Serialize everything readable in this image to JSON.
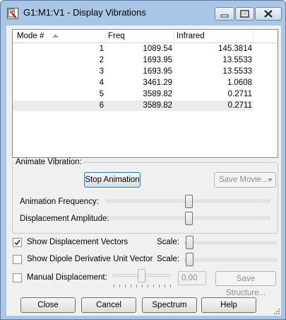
{
  "window": {
    "title": "G1:M1:V1 - Display Vibrations"
  },
  "table": {
    "headers": {
      "mode": "Mode #",
      "freq": "Freq",
      "infrared": "Infrared"
    },
    "rows": [
      {
        "mode": "1",
        "freq": "1089.54",
        "infrared": "145.3814"
      },
      {
        "mode": "2",
        "freq": "1693.95",
        "infrared": "13.5533"
      },
      {
        "mode": "3",
        "freq": "1693.95",
        "infrared": "13.5533"
      },
      {
        "mode": "4",
        "freq": "3461.29",
        "infrared": "1.0608"
      },
      {
        "mode": "5",
        "freq": "3589.82",
        "infrared": "0.2711"
      },
      {
        "mode": "6",
        "freq": "3589.82",
        "infrared": "0.2711"
      }
    ],
    "selected_row": 6
  },
  "animate": {
    "group_label": "Animate Vibration:",
    "stop_button": "Stop Animation",
    "save_movie_button": "Save Movie...",
    "frequency_label": "Animation Frequency:",
    "frequency_level": 0.5,
    "amplitude_label": "Displacement Amplitude:",
    "amplitude_level": 0.5
  },
  "options": {
    "show_vectors": {
      "label": "Show Displacement Vectors",
      "checked": true,
      "scale_label": "Scale:",
      "scale_level": 0
    },
    "show_dipole": {
      "label": "Show Dipole Derivative Unit Vector",
      "checked": false,
      "scale_label": "Scale:",
      "scale_level": 0
    },
    "manual": {
      "label": "Manual Displacement:",
      "checked": false,
      "value": "0.00",
      "level": 0.5
    },
    "save_structure_button": "Save Structure..."
  },
  "footer": {
    "close": "Close",
    "cancel": "Cancel",
    "spectrum": "Spectrum",
    "help": "Help"
  },
  "colors": {
    "window_frame": "#a9c6e6",
    "client": "#f0f0f0",
    "selected_row": "#ececec"
  }
}
